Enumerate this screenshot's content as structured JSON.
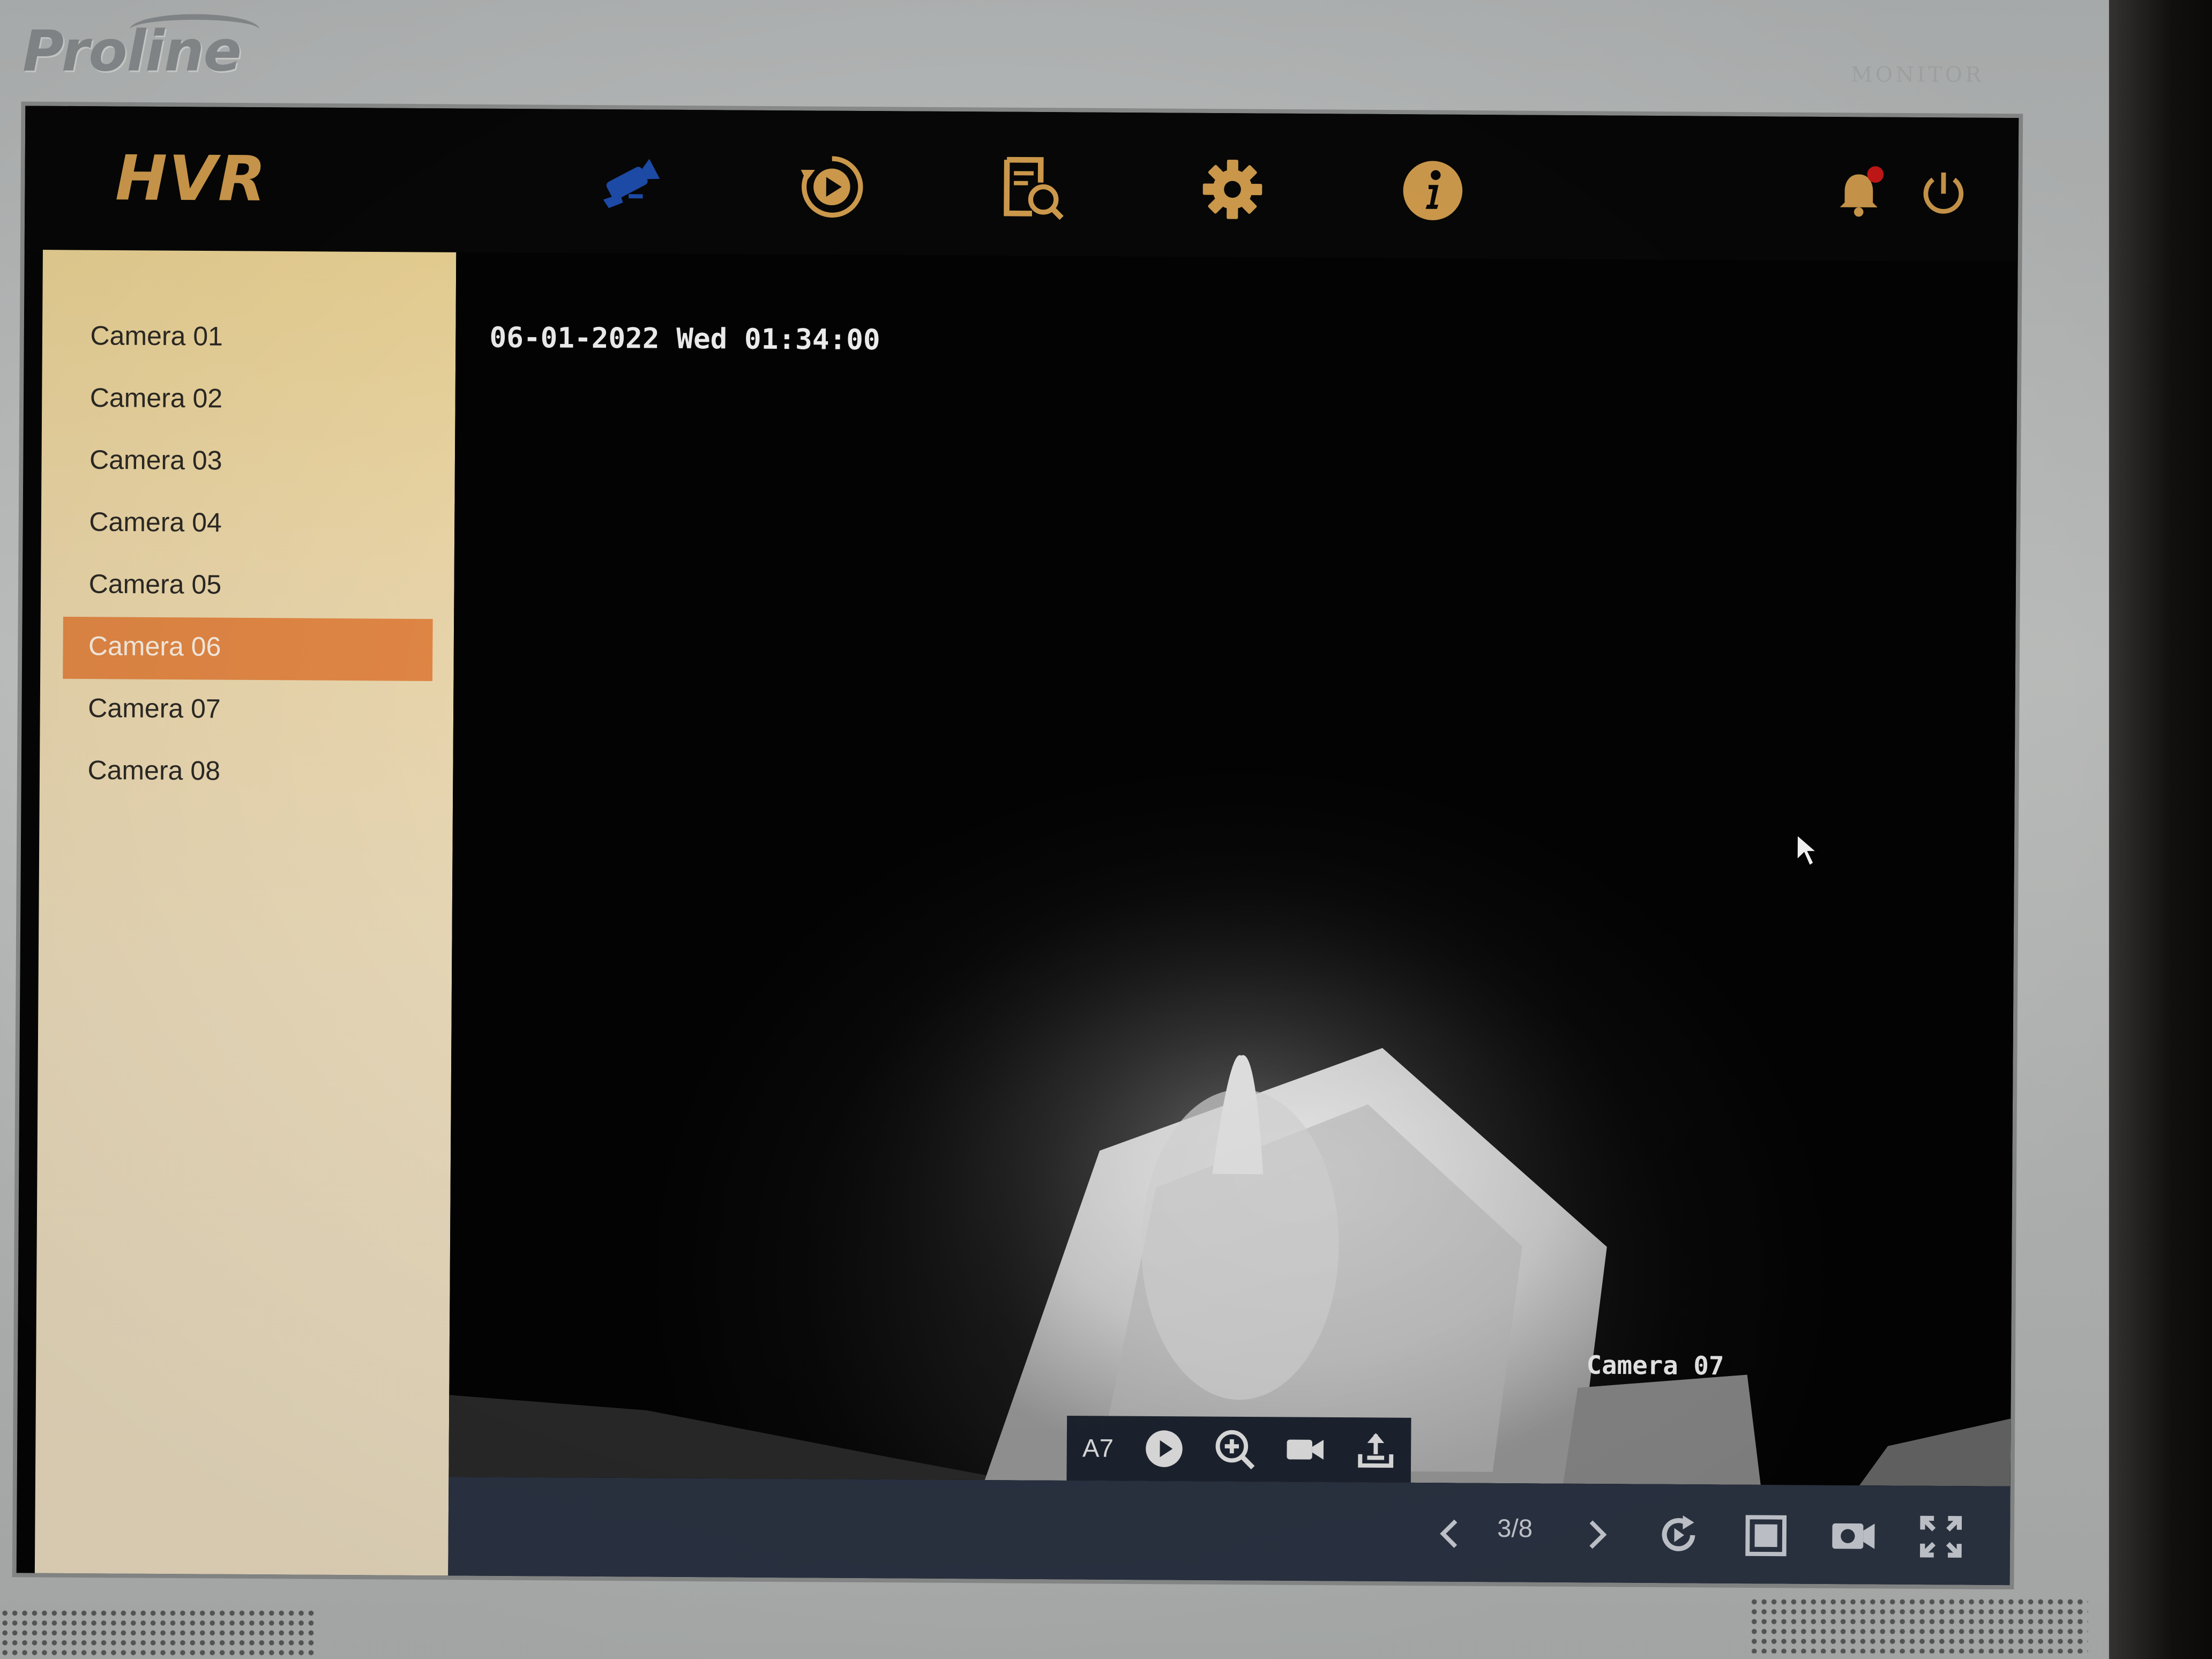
{
  "device": {
    "brand": "Proline",
    "monitor_label": "MONITOR"
  },
  "app": {
    "logo": "HVR"
  },
  "nav": {
    "icons": [
      "live-view-camera-icon",
      "playback-icon",
      "search-file-icon",
      "settings-gear-icon",
      "info-icon"
    ],
    "selected": "live-view-camera-icon",
    "notification_badge": true
  },
  "sidebar": {
    "cameras": [
      {
        "label": "Camera 01"
      },
      {
        "label": "Camera 02"
      },
      {
        "label": "Camera 03"
      },
      {
        "label": "Camera 04"
      },
      {
        "label": "Camera 05"
      },
      {
        "label": "Camera 06",
        "selected": true
      },
      {
        "label": "Camera 07"
      },
      {
        "label": "Camera 08"
      }
    ]
  },
  "video": {
    "timestamp": "06-01-2022 Wed 01:34:00",
    "camera_name": "Camera 07",
    "toolbar": {
      "channel_label": "A7",
      "buttons": [
        "play-icon",
        "zoom-in-icon",
        "record-icon",
        "export-icon"
      ]
    }
  },
  "bottom_bar": {
    "page_indicator": "3/8",
    "buttons": [
      "prev-page-icon",
      "next-page-icon",
      "refresh-icon",
      "single-layout-icon",
      "24h-record-icon",
      "fullscreen-icon"
    ]
  },
  "colors": {
    "accent": "#d6a04f",
    "selected_item": "#e88b47",
    "nav_active": "#1f4fb0",
    "badge": "#d01818",
    "bottom_bar": "#2c3444"
  }
}
